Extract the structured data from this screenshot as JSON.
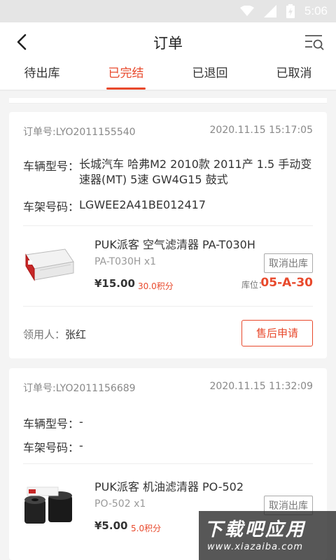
{
  "status_bar": {
    "time": "5:06"
  },
  "header": {
    "title": "订单"
  },
  "tabs": [
    {
      "label": "待出库",
      "active": false
    },
    {
      "label": "已完结",
      "active": true
    },
    {
      "label": "已退回",
      "active": false
    },
    {
      "label": "已取消",
      "active": false
    }
  ],
  "orders": [
    {
      "order_no": "订单号:LYO2011155540",
      "datetime": "2020.11.15 15:17:05",
      "vehicle_label": "车辆型号：",
      "vehicle_value": "长城汽车 哈弗M2 2010款 2011产 1.5 手动变速器(MT) 5速 GW4G15  鼓式",
      "vin_label": "车架号码：",
      "vin_value": "LGWEE2A41BE012417",
      "product_name": "PUK派客 空气滤清器 PA-T030H",
      "product_code": "PA-T030H x1",
      "cancel_label": "取消出库",
      "price": "¥15.00",
      "points": "30.0积分",
      "location_label": "库位：",
      "location_value": "05-A-30",
      "receiver_label": "领用人：",
      "receiver_name": "张红",
      "after_sale_label": "售后申请"
    },
    {
      "order_no": "订单号:LYO2011156689",
      "datetime": "2020.11.15 11:32:09",
      "vehicle_label": "车辆型号：",
      "vehicle_value": "-",
      "vin_label": "车架号码：",
      "vin_value": "-",
      "product_name": "PUK派客 机油滤清器 PO-502",
      "product_code": "PO-502 x1",
      "cancel_label": "取消出库",
      "price": "¥5.00",
      "points": "5.0积分"
    }
  ],
  "watermark": {
    "main": "下载吧应用",
    "sub": "www.xiazaiba.com"
  },
  "colors": {
    "accent": "#e8492c"
  }
}
